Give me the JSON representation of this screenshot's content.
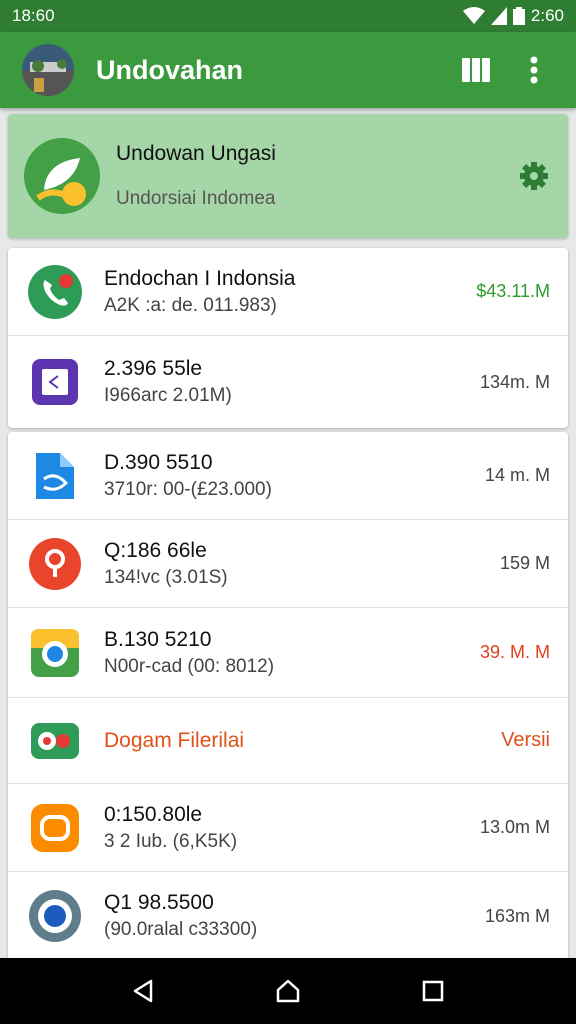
{
  "status": {
    "time_left": "18:60",
    "time_right": "2:60"
  },
  "app_bar": {
    "title": "Undovahan"
  },
  "header": {
    "title": "Undowan Ungasi",
    "subtitle": "Undorsiai Indomea"
  },
  "list1": [
    {
      "title": "Endochan I Indonsia",
      "subtitle": "A2K :a: de. 011.983)",
      "value": "$43.11.M",
      "icon": "phone-icon"
    },
    {
      "title": "2.396 55le",
      "subtitle": "I966arc 2.01M)",
      "value": "134m. M",
      "icon": "purple-app-icon"
    }
  ],
  "list2": [
    {
      "title": "D.390 5510",
      "subtitle": "3710r: 00-(£23.000)",
      "value": "14 m. M",
      "icon": "blue-app-icon"
    },
    {
      "title": "Q:186 66le",
      "subtitle": "134!vc (3.01S)",
      "value": "159 M",
      "icon": "red-pin-icon"
    },
    {
      "title": "B.130 5210",
      "subtitle": "N00r-cad (00: 8012)",
      "value": "39. M. M",
      "icon": "chrome-like-icon"
    },
    {
      "title": "Dogam Filerilai",
      "subtitle": "",
      "value": "Versii",
      "icon": "toggle-app-icon"
    },
    {
      "title": "0:150.80le",
      "subtitle": "3 2 Iub. (6,K5K)",
      "value": "13.0m M",
      "icon": "orange-app-icon"
    },
    {
      "title": "Q1 98.5500",
      "subtitle": "(90.0ralal c33300)",
      "value": "163m M",
      "icon": "camera-icon"
    }
  ],
  "colors": {
    "primary": "#3b9a3e",
    "status": "#2e7d32",
    "header_card": "#a5d6a7",
    "accent_orange": "#e0501a",
    "accent_green": "#2e9b2e"
  }
}
